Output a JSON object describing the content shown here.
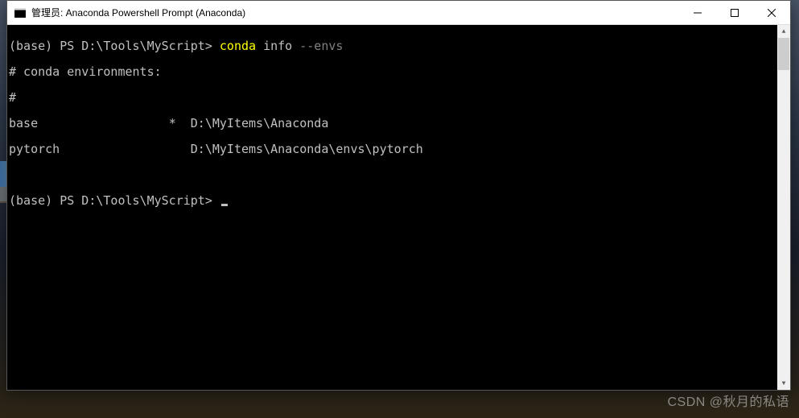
{
  "window": {
    "title": "管理员: Anaconda Powershell Prompt (Anaconda)"
  },
  "terminal": {
    "prompt1_prefix": "(base) PS D:\\Tools\\MyScript> ",
    "prompt1_cmd": "conda ",
    "prompt1_args1": "info ",
    "prompt1_args2": "--envs",
    "line2": "# conda environments:",
    "line3": "#",
    "env1_name": "base",
    "env1_marker": "*",
    "env1_path": "D:\\MyItems\\Anaconda",
    "env2_name": "pytorch",
    "env2_path": "D:\\MyItems\\Anaconda\\envs\\pytorch",
    "prompt2": "(base) PS D:\\Tools\\MyScript> "
  },
  "watermark": "CSDN @秋月的私语"
}
